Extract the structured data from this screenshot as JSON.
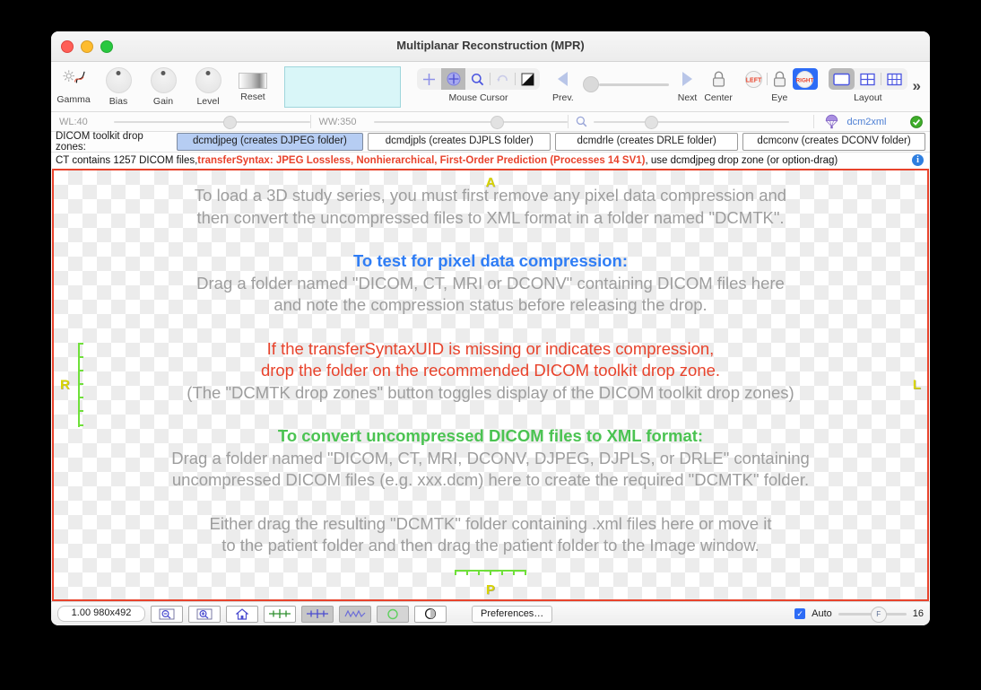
{
  "window": {
    "title": "Multiplanar Reconstruction (MPR)",
    "close_label": "close",
    "minimize_label": "minimize",
    "maximize_label": "maximize"
  },
  "toolbar": {
    "gamma_label": "Gamma",
    "bias_label": "Bias",
    "gain_label": "Gain",
    "level_label": "Level",
    "reset_label": "Reset",
    "mouse_cursor_label": "Mouse Cursor",
    "prev_label": "Prev.",
    "next_label": "Next",
    "center_label": "Center",
    "eye_label": "Eye",
    "layout_label": "Layout",
    "eye_left_label": "LEFT",
    "eye_right_label": "RIGHT",
    "overflow_label": "»"
  },
  "sliders": {
    "wl_label": "WL:40",
    "ww_label": "WW:350",
    "dcm2xml_label": "dcm2xml"
  },
  "dropzones": {
    "label": "DICOM toolkit drop zones:",
    "buttons": [
      {
        "label": "dcmdjpeg (creates DJPEG folder)",
        "selected": true
      },
      {
        "label": "dcmdjpls (creates DJPLS folder)",
        "selected": false
      },
      {
        "label": "dcmdrle (creates DRLE folder)",
        "selected": false
      },
      {
        "label": "dcmconv (creates DCONV folder)",
        "selected": false
      }
    ]
  },
  "status": {
    "prefix": "CT contains 1257 DICOM files, ",
    "highlight": "transferSyntax: JPEG Lossless, Nonhierarchical, First-Order Prediction (Processes 14 SV1)",
    "suffix": ", use dcmdjpeg drop zone (or option-drag)",
    "info_glyph": "i",
    "highlight_color": "#e8432c"
  },
  "canvas": {
    "orientation": {
      "anterior": "A",
      "posterior": "P",
      "right": "R",
      "left": "L"
    },
    "marker_color": "#d8d400",
    "ruler_color": "#6fe03a",
    "border_color": "#e8432c",
    "message_blocks": [
      {
        "style": "grey",
        "lines": [
          "To load a 3D study series, you must first remove any pixel data compression and",
          "then convert the uncompressed files to XML format in a folder named \"DCMTK\"."
        ]
      },
      {
        "style": "spacer",
        "lines": []
      },
      {
        "style": "blue",
        "lines": [
          "To test for pixel data compression:"
        ]
      },
      {
        "style": "grey",
        "lines": [
          "Drag a folder named \"DICOM, CT, MRI or DCONV\" containing DICOM files here",
          "and note the compression status before releasing the drop."
        ]
      },
      {
        "style": "spacer",
        "lines": []
      },
      {
        "style": "red",
        "lines": [
          "If the transferSyntaxUID is missing or indicates compression,",
          "drop the folder on the recommended DICOM toolkit drop zone."
        ]
      },
      {
        "style": "grey",
        "lines": [
          "(The \"DCMTK drop zones\" button toggles display of the DICOM toolkit drop zones)"
        ]
      },
      {
        "style": "spacer",
        "lines": []
      },
      {
        "style": "green",
        "lines": [
          "To convert uncompressed DICOM files to XML format:"
        ]
      },
      {
        "style": "grey",
        "lines": [
          "Drag a folder named \"DICOM, CT, MRI, DCONV, DJPEG, DJPLS, or DRLE\" containing",
          "uncompressed DICOM files (e.g. xxx.dcm) here to create the required \"DCMTK\" folder."
        ]
      },
      {
        "style": "spacer",
        "lines": []
      },
      {
        "style": "grey",
        "lines": [
          "Either drag the resulting \"DCMTK\" folder containing .xml files here or move it",
          "to the patient folder and then drag the patient folder to the Image window."
        ]
      }
    ]
  },
  "bottombar": {
    "zoom_value": "1.00 980x492",
    "preferences_label": "Preferences…",
    "auto_label": "Auto",
    "f_label": "F",
    "f_value": "16",
    "auto_checked": true,
    "check_glyph": "✓"
  }
}
